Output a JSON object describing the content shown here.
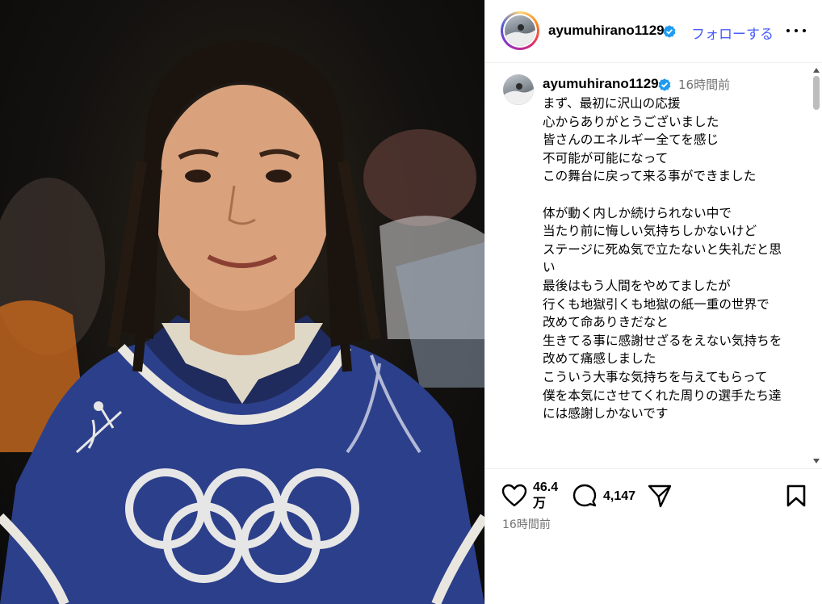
{
  "post": {
    "username": "ayumuhirano1129",
    "follow_label": "フォローする",
    "caption_time": "16時間前",
    "caption_text": "まず、最初に沢山の応援\n心からありがとうございました\n皆さんのエネルギー全てを感じ\n不可能が可能になって\nこの舞台に戻って来る事ができました\n\n体が動く内しか続けられない中で\n当たり前に悔しい気持ちしかないけど\nステージに死ぬ気で立たないと失礼だと思い\n最後はもう人間をやめてましたが\n行くも地獄引くも地獄の紙一重の世界で\n改めて命ありきだなと\n生きてる事に感謝せざるをえない気持ちを改めて痛感しました\nこういう大事な気持ちを与えてもらって\n僕を本気にさせてくれた周りの選手たち達には感謝しかないです",
    "likes": "46.4\n万",
    "comments": "4,147",
    "timestamp": "16時間前"
  },
  "icons": {
    "verified": "verified-badge-icon",
    "more": "more-options-icon",
    "like": "heart-icon",
    "comment": "comment-icon",
    "share": "share-icon",
    "save": "bookmark-icon"
  },
  "colors": {
    "follow": "#4a5df9",
    "verified": "#1d9bf0",
    "muted": "#737373"
  }
}
